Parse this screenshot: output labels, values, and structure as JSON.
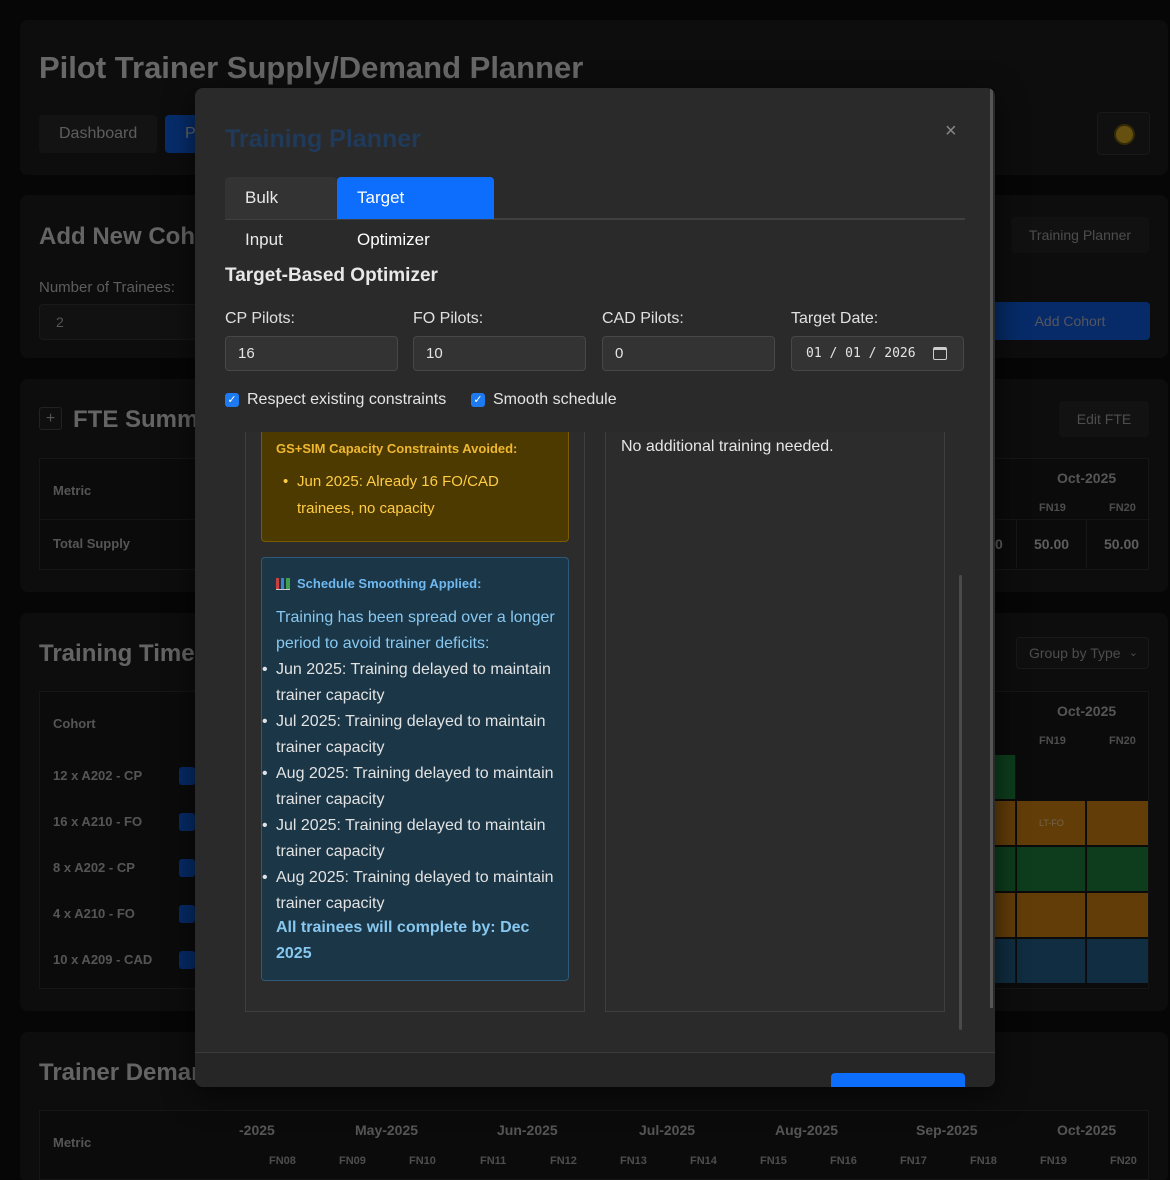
{
  "app": {
    "title": "Pilot Trainer Supply/Demand Planner",
    "nav": {
      "dashboard": "Dashboard",
      "planner_partial": "Pl"
    },
    "theme_icon": "sun-icon"
  },
  "cohort_section": {
    "title": "Add New Coh",
    "trainees_label": "Number of Trainees:",
    "trainees_value": "2",
    "training_planner_button": "Training Planner",
    "add_cohort_button": "Add Cohort"
  },
  "fte_section": {
    "expand_icon": "+",
    "title": "FTE Summa",
    "edit_button": "Edit FTE",
    "metric_header": "Metric",
    "month_header": "Oct-2025",
    "fn_headers": [
      "FN19",
      "FN20"
    ],
    "row_label": "Total Supply",
    "row_partial": "0",
    "row_values": [
      "50.00",
      "50.00"
    ]
  },
  "timeline_section": {
    "title": "Training Time",
    "group_select": "Group by Type",
    "cohort_header": "Cohort",
    "month_header": "Oct-2025",
    "fn_headers": [
      "FN19",
      "FN20"
    ],
    "rows": [
      "12 x A202 - CP",
      "16 x A210 - FO",
      "8 x A202 - CP",
      "4 x A210 - FO",
      "10 x A209 - CAD"
    ],
    "bar_label": "LT-FO",
    "colors": {
      "green": "#1a7a3a",
      "orange": "#c47a10",
      "blue": "#205a82"
    }
  },
  "demand_section": {
    "title": "Trainer Deman",
    "metric_header": "Metric",
    "months": [
      "-2025",
      "May-2025",
      "Jun-2025",
      "Jul-2025",
      "Aug-2025",
      "Sep-2025",
      "Oct-2025"
    ],
    "fns": [
      "FN08",
      "FN09",
      "FN10",
      "FN11",
      "FN12",
      "FN13",
      "FN14",
      "FN15",
      "FN16",
      "FN17",
      "FN18",
      "FN19",
      "FN20"
    ]
  },
  "modal": {
    "title": "Training Planner",
    "close_label": "×",
    "tabs": [
      "Bulk Input",
      "Target Optimizer"
    ],
    "active_tab": "Target Optimizer",
    "optimizer_title": "Target-Based Optimizer",
    "fields": [
      {
        "label": "CP Pilots:",
        "value": "16"
      },
      {
        "label": "FO Pilots:",
        "value": "10"
      },
      {
        "label": "CAD Pilots:",
        "value": "0"
      },
      {
        "label": "Target Date:",
        "value": "01 / 01 / 2026"
      }
    ],
    "checkboxes": [
      "Respect existing constraints",
      "Smooth schedule"
    ],
    "constraints": {
      "title": "GS+SIM Capacity Constraints Avoided:",
      "items": [
        "Jun 2025: Already 16 FO/CAD trainees, no capacity"
      ]
    },
    "smoothing": {
      "title": "Schedule Smoothing Applied:",
      "intro": "Training has been spread over a longer period to avoid trainer deficits:",
      "items": [
        "Jun 2025: Training delayed to maintain trainer capacity",
        "Jul 2025: Training delayed to maintain trainer capacity",
        "Aug 2025: Training delayed to maintain trainer capacity",
        "Jul 2025: Training delayed to maintain trainer capacity",
        "Aug 2025: Training delayed to maintain trainer capacity"
      ],
      "summary": "All trainees will complete by: Dec 2025",
      "icon": "chart-icon"
    },
    "result_text": "No additional training needed."
  }
}
